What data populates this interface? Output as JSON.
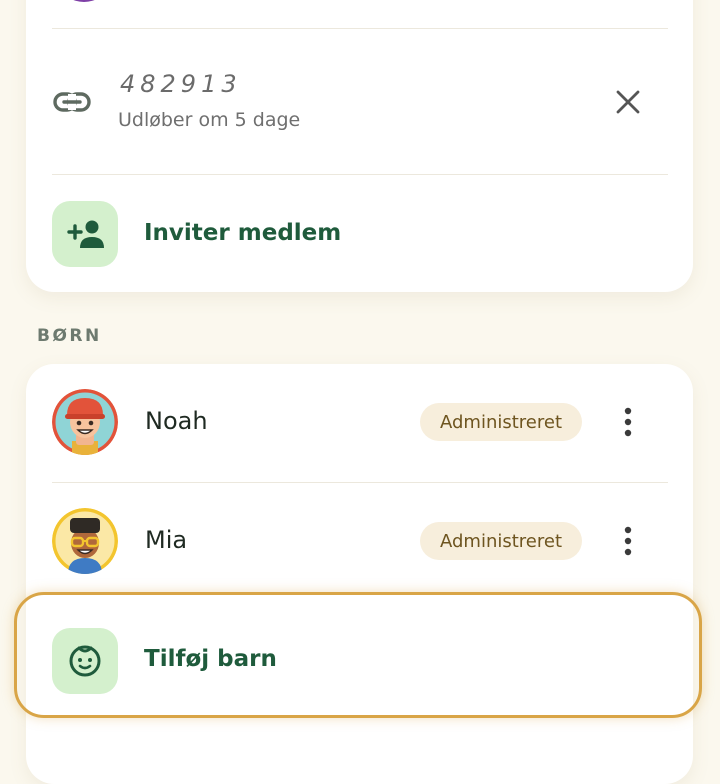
{
  "invite_link": {
    "icon": "link-icon",
    "code": "482913",
    "expiry": "Udløber om 5 dage",
    "close_icon": "close-icon"
  },
  "invite_member": {
    "icon": "person-add-icon",
    "label": "Inviter medlem"
  },
  "children_section": {
    "title": "BØRN",
    "children": [
      {
        "name": "Noah",
        "badge": "Administreret",
        "avatar": "avatar-noah",
        "menu_icon": "more-vertical-icon"
      },
      {
        "name": "Mia",
        "badge": "Administreret",
        "avatar": "avatar-mia",
        "menu_icon": "more-vertical-icon"
      }
    ],
    "add_child": {
      "icon": "baby-face-icon",
      "label": "Tilføj barn"
    }
  },
  "colors": {
    "accent_green": "#1f5b3c",
    "tile_green": "#d4f0cd",
    "badge_bg": "#f7eedc",
    "highlight": "#d9a547",
    "background": "#fbf8ee"
  }
}
